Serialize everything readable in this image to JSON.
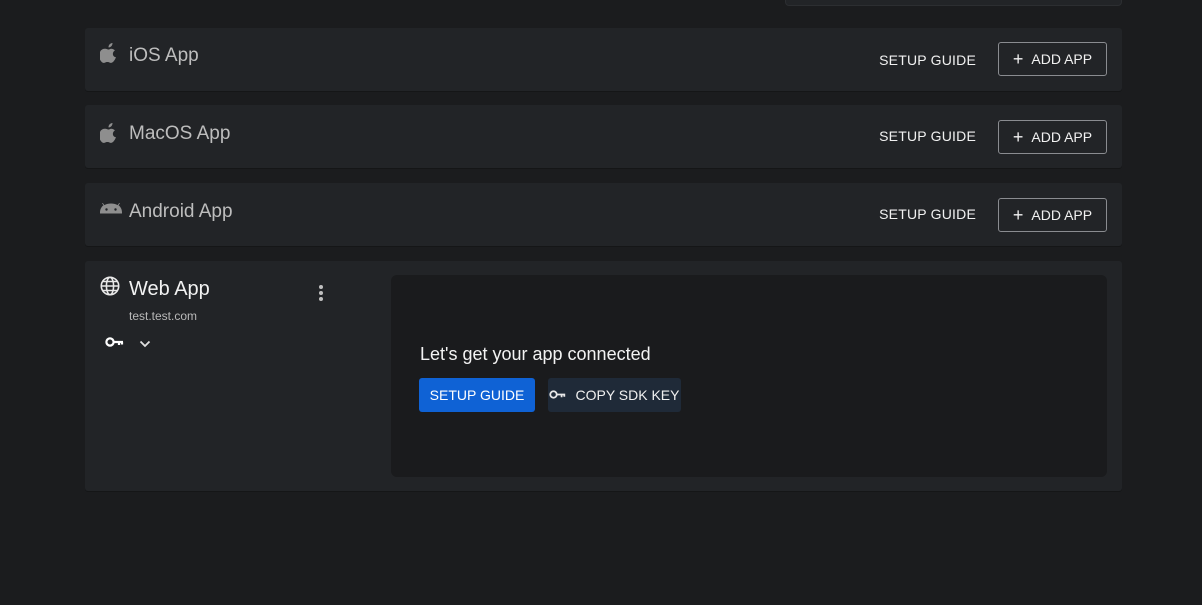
{
  "apps": [
    {
      "title": "iOS App",
      "icon": "apple-icon",
      "setup_label": "SETUP GUIDE",
      "add_label": "ADD APP"
    },
    {
      "title": "MacOS App",
      "icon": "apple-icon",
      "setup_label": "SETUP GUIDE",
      "add_label": "ADD APP"
    },
    {
      "title": "Android App",
      "icon": "android-icon",
      "setup_label": "SETUP GUIDE",
      "add_label": "ADD APP"
    }
  ],
  "web_app": {
    "title": "Web App",
    "domain": "test.test.com",
    "icon": "globe-icon",
    "panel": {
      "heading": "Let's get your app connected",
      "setup_label": "SETUP GUIDE",
      "sdk_label": "COPY SDK KEY"
    }
  },
  "colors": {
    "background": "#1b1c1e",
    "card": "#222427",
    "primary": "#0f62d5",
    "sdk_button": "#1f2a38"
  }
}
